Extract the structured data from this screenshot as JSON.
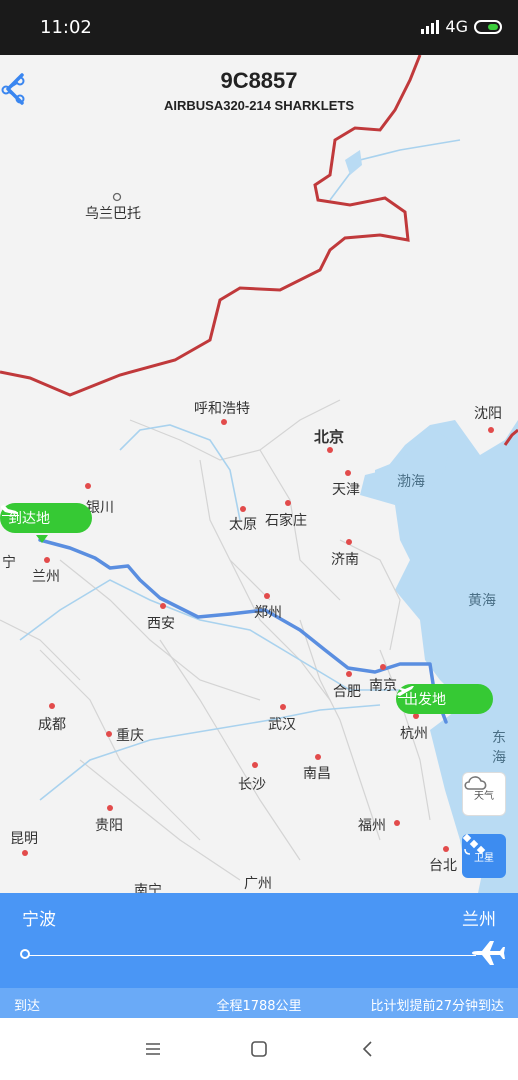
{
  "status_bar": {
    "time": "11:02",
    "network": "4G"
  },
  "header": {
    "flight_number": "9C8857",
    "aircraft": "AIRBUSA320-214 SHARKLETS"
  },
  "map": {
    "cities": [
      {
        "name": "乌兰巴托"
      },
      {
        "name": "呼和浩特"
      },
      {
        "name": "北京"
      },
      {
        "name": "沈阳"
      },
      {
        "name": "银川"
      },
      {
        "name": "天津"
      },
      {
        "name": "太原"
      },
      {
        "name": "石家庄"
      },
      {
        "name": "宁"
      },
      {
        "name": "兰州"
      },
      {
        "name": "济南"
      },
      {
        "name": "西安"
      },
      {
        "name": "郑州"
      },
      {
        "name": "合肥"
      },
      {
        "name": "南京"
      },
      {
        "name": "成都"
      },
      {
        "name": "重庆"
      },
      {
        "name": "武汉"
      },
      {
        "name": "杭州"
      },
      {
        "name": "长沙"
      },
      {
        "name": "南昌"
      },
      {
        "name": "昆明"
      },
      {
        "name": "贵阳"
      },
      {
        "name": "福州"
      },
      {
        "name": "台北"
      },
      {
        "name": "南宁"
      },
      {
        "name": "广州"
      }
    ],
    "seas": [
      {
        "name": "渤海"
      },
      {
        "name": "黄海"
      },
      {
        "name": "东海"
      }
    ],
    "arrival_label": "到达地",
    "departure_label": "出发地",
    "weather_button": "天气",
    "satellite_button": "卫星"
  },
  "trip": {
    "origin": "宁波",
    "destination": "兰州",
    "status": "到达",
    "distance": "全程1788公里",
    "delay_info": "比计划提前27分钟到达"
  },
  "colors": {
    "accent": "#4a96f5",
    "tag_green": "#36c934",
    "route": "#5a8ee0",
    "border": "#c0393b"
  }
}
